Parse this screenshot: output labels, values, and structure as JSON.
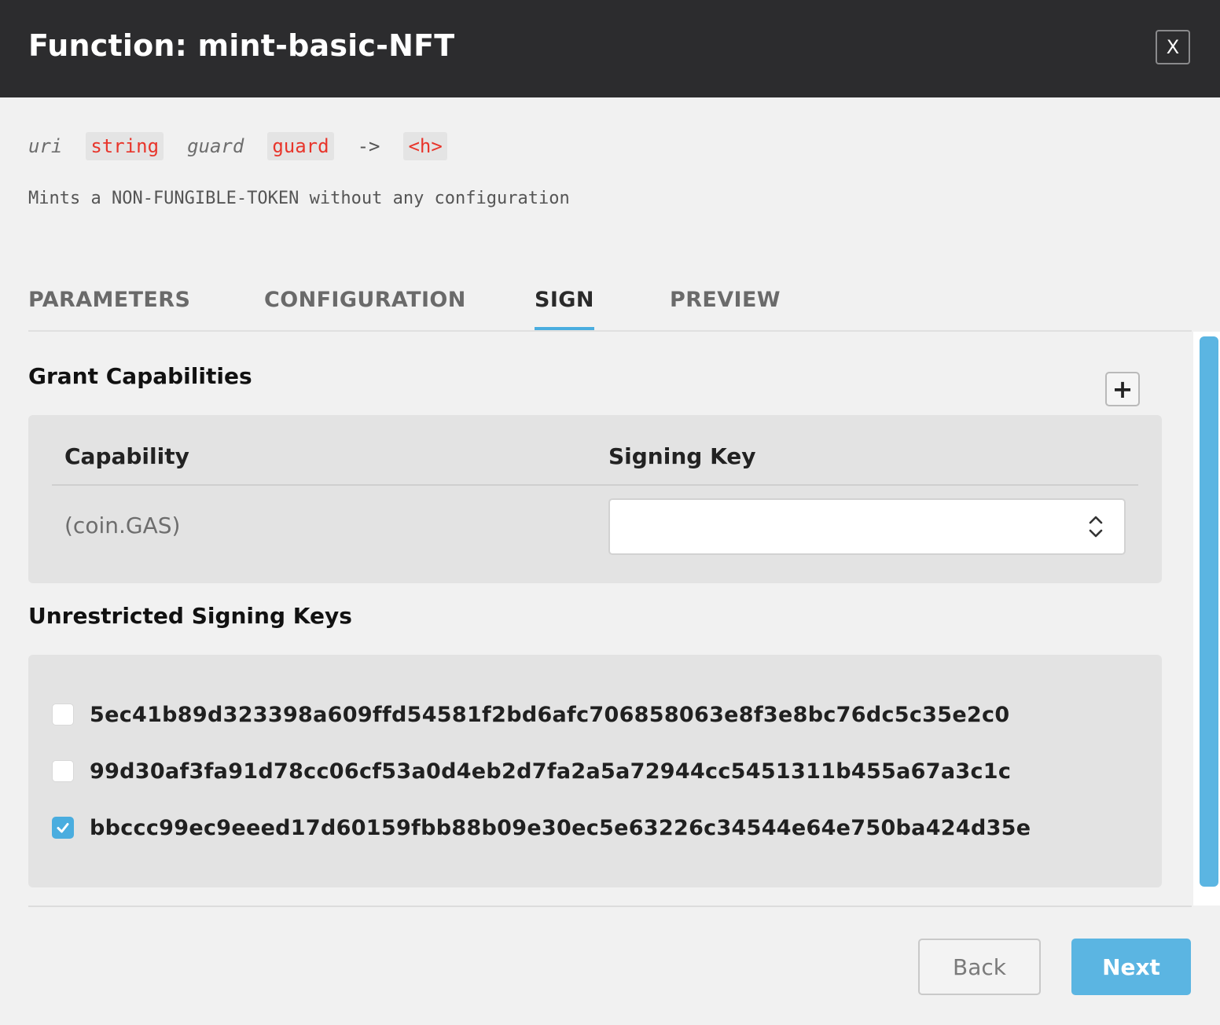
{
  "header": {
    "title": "Function: mint-basic-NFT",
    "close_label": "X"
  },
  "signature": {
    "params": [
      {
        "name": "uri",
        "type": "string"
      },
      {
        "name": "guard",
        "type": "guard"
      }
    ],
    "arrow": "->",
    "return_type": "<h>"
  },
  "doc": "Mints a NON-FUNGIBLE-TOKEN without any configuration",
  "tabs": [
    {
      "label": "PARAMETERS",
      "active": false
    },
    {
      "label": "CONFIGURATION",
      "active": false
    },
    {
      "label": "SIGN",
      "active": true
    },
    {
      "label": "PREVIEW",
      "active": false
    }
  ],
  "grant": {
    "title": "Grant Capabilities",
    "add_label": "+",
    "col_capability": "Capability",
    "col_signing_key": "Signing Key",
    "rows": [
      {
        "capability": "(coin.GAS)",
        "signing_key": ""
      }
    ]
  },
  "unrestricted": {
    "title": "Unrestricted Signing Keys",
    "keys": [
      {
        "key": "5ec41b89d323398a609ffd54581f2bd6afc706858063e8f3e8bc76dc5c35e2c0",
        "checked": false
      },
      {
        "key": "99d30af3fa91d78cc06cf53a0d4eb2d7fa2a5a72944cc5451311b455a67a3c1c",
        "checked": false
      },
      {
        "key": "bbccc99ec9eeed17d60159fbb88b09e30ec5e63226c34544e64e750ba424d35e",
        "checked": true
      }
    ]
  },
  "footer": {
    "back_label": "Back",
    "next_label": "Next"
  },
  "colors": {
    "accent": "#4aaddf",
    "titlebar": "#2c2c2e",
    "type_red": "#e8352b"
  }
}
